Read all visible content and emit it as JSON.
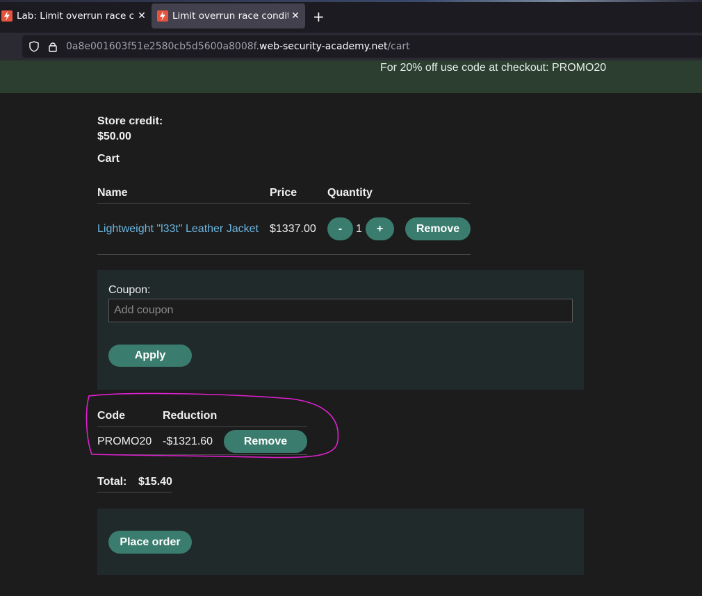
{
  "browser": {
    "tabs": [
      {
        "title": "Lab: Limit overrun race c",
        "close": "✕"
      },
      {
        "title": "Limit overrun race condit",
        "close": "✕"
      }
    ],
    "new_tab": "+",
    "url_prefix": "0a8e001603f51e2580cb5d5600a8008f.",
    "url_domain": "web-security-academy.net",
    "url_path": "/cart"
  },
  "banner": {
    "text": "For 20% off use code at checkout: PROMO20"
  },
  "store_credit": {
    "label": "Store credit:",
    "value": "$50.00"
  },
  "cart": {
    "heading": "Cart",
    "columns": {
      "name": "Name",
      "price": "Price",
      "quantity": "Quantity"
    },
    "items": [
      {
        "name": "Lightweight \"l33t\" Leather Jacket",
        "price": "$1337.00",
        "minus": "-",
        "qty": "1",
        "plus": "+",
        "remove": "Remove"
      }
    ]
  },
  "coupon": {
    "label": "Coupon:",
    "placeholder": "Add coupon",
    "apply": "Apply"
  },
  "applied": {
    "columns": {
      "code": "Code",
      "reduction": "Reduction"
    },
    "rows": [
      {
        "code": "PROMO20",
        "reduction": "-$1321.60",
        "remove": "Remove"
      }
    ]
  },
  "total": {
    "label": "Total:",
    "value": "$15.40"
  },
  "order": {
    "place_order": "Place order"
  },
  "colors": {
    "accent": "#3a7d6e",
    "annotation": "#e020d0",
    "banner": "#2b3e2f",
    "panel": "#212a2b"
  }
}
